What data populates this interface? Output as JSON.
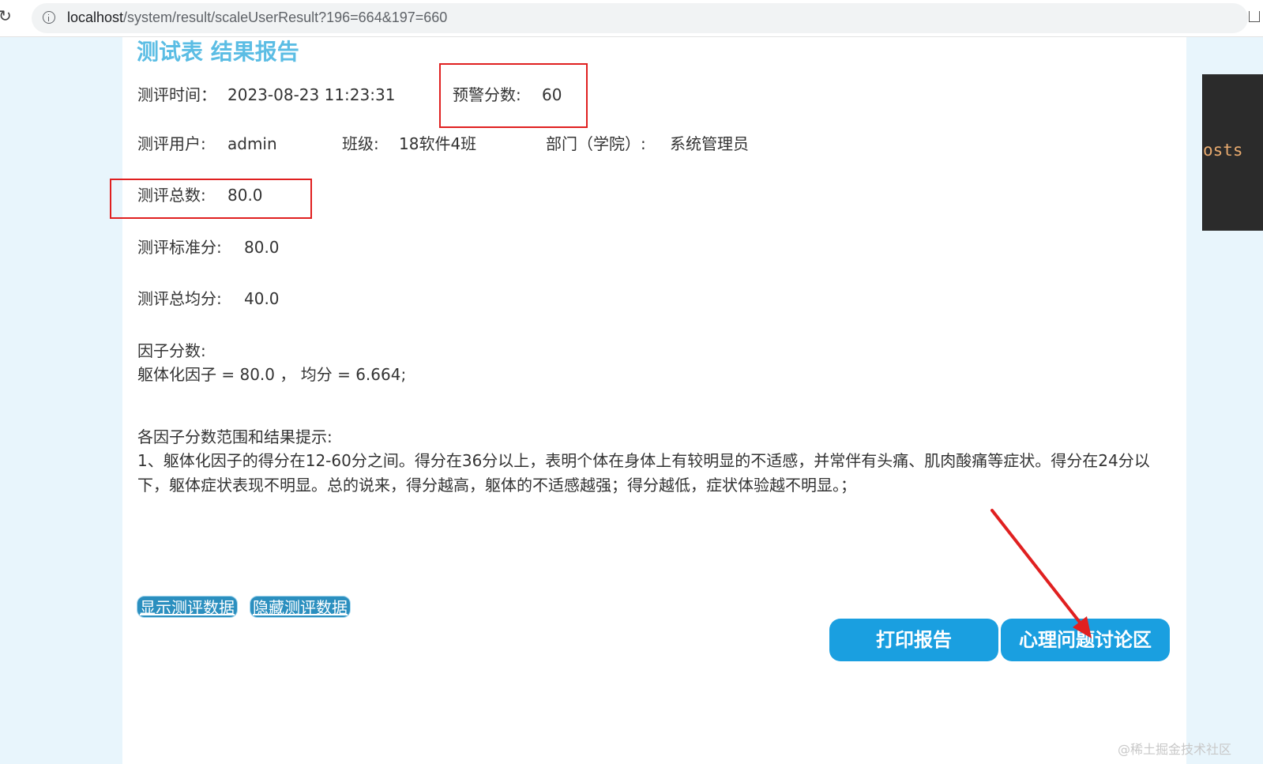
{
  "browser": {
    "host": "localhost",
    "path": "/system/result/scaleUserResult?196=664&197=660"
  },
  "report": {
    "title": "测试表 结果报告",
    "eval_time_label": "测评时间：",
    "eval_time_value": "2023-08-23 11:23:31",
    "warning_label": "预警分数:",
    "warning_value": "60",
    "user_label": "测评用户:",
    "user_value": "admin",
    "class_label": "班级:",
    "class_value": "18软件4班",
    "dept_label": "部门（学院）:",
    "dept_value": "系统管理员",
    "total_label": "测评总数:",
    "total_value": "80.0",
    "standard_label": "测评标准分:",
    "standard_value": "80.0",
    "avg_label": "测评总均分:",
    "avg_value": "40.0",
    "factor_label": "因子分数:",
    "factor_line": "躯体化因子 = 80.0 ， 均分 = 6.664;",
    "range_label": "各因子分数范围和结果提示:",
    "range_text": "1、躯体化因子的得分在12-60分之间。得分在36分以上，表明个体在身体上有较明显的不适感，并常伴有头痛、肌肉酸痛等症状。得分在24分以下，躯体症状表现不明显。总的说来，得分越高，躯体的不适感越强；得分越低，症状体验越不明显。；"
  },
  "actions": {
    "show_data": "显示测评数据",
    "hide_data": "隐藏测评数据",
    "print_report": "打印报告",
    "discussion": "心理问题讨论区"
  },
  "side_editor_text": "osts",
  "watermark": "@稀土掘金技术社区",
  "colors": {
    "title": "#5bbde4",
    "button": "#1a9fe0",
    "annotation": "#e02020"
  }
}
